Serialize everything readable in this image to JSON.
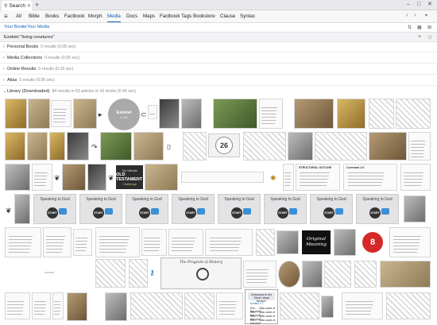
{
  "window": {
    "tab_label": "Search"
  },
  "menu": {
    "items": [
      "All",
      "Bible",
      "Books",
      "Factbook",
      "Morph",
      "Media",
      "Docs",
      "Maps",
      "Factbook Tags",
      "Bookstore",
      "Clause",
      "Syntax"
    ],
    "active_index": 5
  },
  "breadcrumb": {
    "part1": "Your Books",
    "sep": "›",
    "part2": "Your Media"
  },
  "query": {
    "text": "Ezekiel \"living creatures\""
  },
  "sections": [
    {
      "label": "Personal Books",
      "count": "0 results (0.05 sec)",
      "expanded": false
    },
    {
      "label": "Media Collections",
      "count": "0 results (0.05 sec)",
      "expanded": false
    },
    {
      "label": "Online Results",
      "count": "0 results (0.16 sec)",
      "expanded": false
    },
    {
      "label": "Atlas",
      "count": "0 results (0.05 sec)",
      "expanded": false
    },
    {
      "label": "Library (Downloaded)",
      "count": "84 results in 63 articles in 10 books (0.46 sec)",
      "expanded": true
    }
  ],
  "thumbnails": {
    "ezekiel_title": "Ezekiel",
    "ezekiel_sub": "1–24",
    "number_card": "26",
    "speaking_title": "Speaking to God",
    "start_label": "START",
    "ot_line1": "The Ultimate",
    "ot_line2": "OLD TESTAMENT",
    "ot_line3": "Challenge",
    "original_line1": "Original",
    "original_line2": "Meaning",
    "stop_number": "8",
    "program_title": "The Program of History",
    "omissions_title": "Omissions in the \"Most Literal Version\"",
    "omissions_rows": [
      "Rev. ... Was some of this text?",
      "Rev. ... Was some of this text?",
      "Rev. ... Was some of this text?",
      "Rev. ... Was some of this text?"
    ],
    "omissions_label": "Ezekiel 1:7",
    "chart_header": "STRUCTURAL OUTLINE",
    "chart_header2": "Covenant 2.0"
  }
}
